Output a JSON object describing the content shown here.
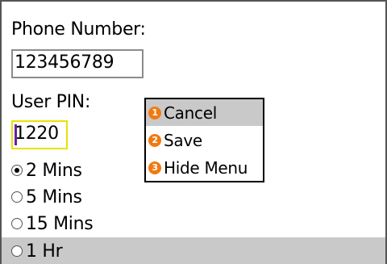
{
  "form": {
    "phone_label": "Phone Number:",
    "phone_value": "123456789",
    "pin_label": "User PIN:",
    "pin_value": "1220"
  },
  "timeout_options": [
    {
      "label": "2 Mins",
      "checked": true
    },
    {
      "label": "5 Mins",
      "checked": false
    },
    {
      "label": "15 Mins",
      "checked": false
    },
    {
      "label": "1 Hr",
      "checked": false,
      "focused": true
    }
  ],
  "menu": {
    "items": [
      {
        "number": "1",
        "label": "Cancel",
        "highlighted": true
      },
      {
        "number": "2",
        "label": "Save",
        "highlighted": false
      },
      {
        "number": "3",
        "label": "Hide Menu",
        "highlighted": false
      }
    ]
  },
  "colors": {
    "highlight": "#c9c9c9",
    "badge": "#f07a12",
    "focus_border": "#e8e200",
    "caret": "#6a1ea8"
  }
}
